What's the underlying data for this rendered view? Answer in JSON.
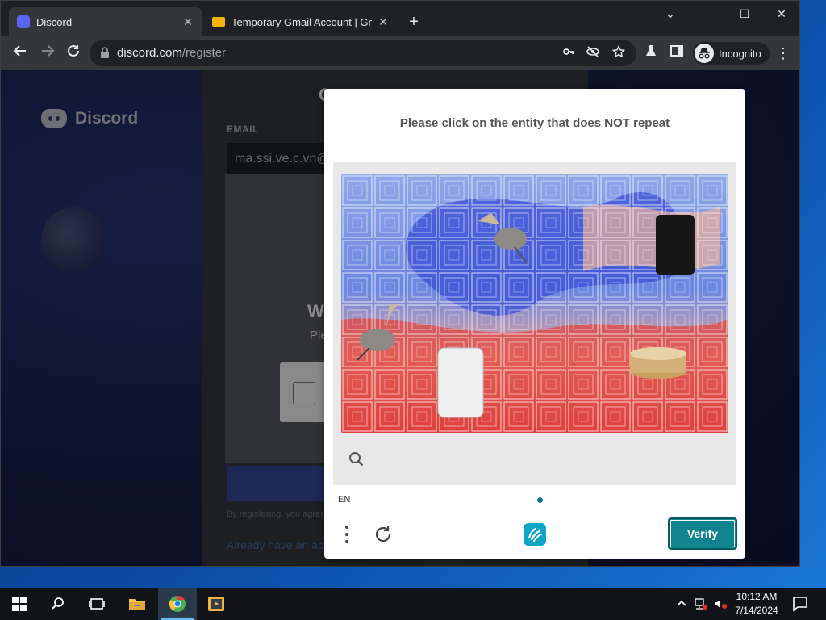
{
  "browser": {
    "tabs": [
      {
        "title": "Discord",
        "active": true,
        "close": "✕"
      },
      {
        "title": "Temporary Gmail Account | Gma",
        "active": false,
        "close": "✕"
      }
    ],
    "new_tab": "+",
    "window_controls": {
      "chevron": "⌄",
      "minimize": "—",
      "maximize": "☐",
      "close": "✕"
    },
    "address": {
      "host": "discord.com",
      "path": "/register"
    },
    "incognito_label": "Incognito",
    "menu": "⋮"
  },
  "discord_page": {
    "logo_text": "Discord",
    "heading": "C",
    "email_label": "EMAIL",
    "email_value": "ma.ssi.ve.c.vn@g",
    "overlay_title": "W",
    "overlay_sub": "Ple",
    "legal_text": "By registering, you agree",
    "login_link": "Already have an acco"
  },
  "captcha": {
    "prompt": "Please click on the entity that does NOT repeat",
    "language": "EN",
    "verify_label": "Verify",
    "accent": "#0f8390"
  },
  "taskbar": {
    "time": "10:12 AM",
    "date": "7/14/2024"
  }
}
